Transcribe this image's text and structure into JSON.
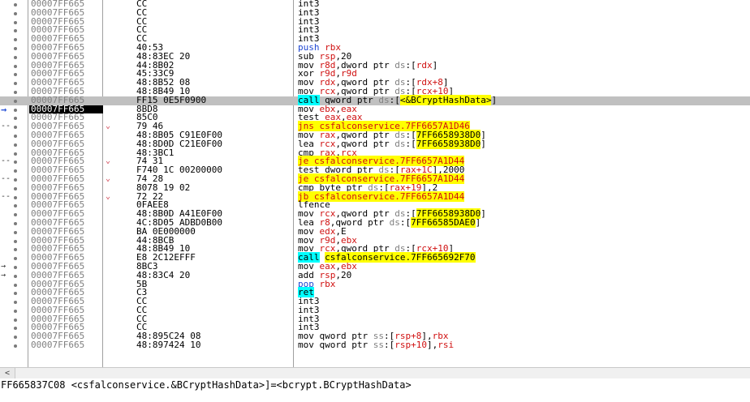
{
  "colors": {
    "call_bg": "#00ffff",
    "jcc_bg": "#ffff00",
    "selected_row": "#c0c0c0",
    "register": "#d01010",
    "push": "#1e46d2"
  },
  "rows": [
    {
      "addr": "00007FF665",
      "bytes": "CC",
      "instr": [
        [
          "int3",
          ""
        ]
      ]
    },
    {
      "addr": "00007FF665",
      "bytes": "CC",
      "instr": [
        [
          "int3",
          ""
        ]
      ]
    },
    {
      "addr": "00007FF665",
      "bytes": "CC",
      "instr": [
        [
          "int3",
          ""
        ]
      ]
    },
    {
      "addr": "00007FF665",
      "bytes": "CC",
      "instr": [
        [
          "int3",
          ""
        ]
      ]
    },
    {
      "addr": "00007FF665",
      "bytes": "CC",
      "instr": [
        [
          "int3",
          ""
        ]
      ]
    },
    {
      "addr": "00007FF665",
      "bytes": "40:53",
      "instr": [
        [
          "push",
          "push"
        ],
        [
          " ",
          ""
        ],
        [
          "rbx",
          "reg"
        ]
      ]
    },
    {
      "addr": "00007FF665",
      "bytes": "48:83EC 20",
      "instr": [
        [
          "sub ",
          ""
        ],
        [
          "rsp",
          "reg"
        ],
        [
          ",20",
          ""
        ]
      ]
    },
    {
      "addr": "00007FF665",
      "bytes": "44:8B02",
      "instr": [
        [
          "mov ",
          ""
        ],
        [
          "r8d",
          "reg"
        ],
        [
          ",dword ptr ",
          ""
        ],
        [
          "ds",
          "seg"
        ],
        [
          ":[",
          ""
        ],
        [
          "rdx",
          "reg"
        ],
        [
          "]",
          ""
        ]
      ]
    },
    {
      "addr": "00007FF665",
      "bytes": "45:33C9",
      "instr": [
        [
          "xor ",
          ""
        ],
        [
          "r9d",
          "reg"
        ],
        [
          ",",
          ""
        ],
        [
          "r9d",
          "reg"
        ]
      ]
    },
    {
      "addr": "00007FF665",
      "bytes": "48:8B52 08",
      "instr": [
        [
          "mov ",
          ""
        ],
        [
          "rdx",
          "reg"
        ],
        [
          ",qword ptr ",
          ""
        ],
        [
          "ds",
          "seg"
        ],
        [
          ":[",
          ""
        ],
        [
          "rdx+8",
          "reg"
        ],
        [
          "]",
          ""
        ]
      ]
    },
    {
      "addr": "00007FF665",
      "bytes": "48:8B49 10",
      "instr": [
        [
          "mov ",
          ""
        ],
        [
          "rcx",
          "reg"
        ],
        [
          ",qword ptr ",
          ""
        ],
        [
          "ds",
          "seg"
        ],
        [
          ":[",
          ""
        ],
        [
          "rcx+10",
          "reg"
        ],
        [
          "]",
          ""
        ]
      ]
    },
    {
      "addr": "00007FF665",
      "bytes": "FF15 0E5F0900",
      "instr": [
        [
          "call",
          "call"
        ],
        [
          " qword ptr ",
          ""
        ],
        [
          "ds",
          "seg"
        ],
        [
          ":[",
          ""
        ],
        [
          "<&BCryptHashData>",
          "tgt"
        ],
        [
          "]",
          ""
        ]
      ],
      "selected": true
    },
    {
      "addr": "00007FF665",
      "bytes": "8BD8",
      "instr": [
        [
          "mov ",
          ""
        ],
        [
          "ebx",
          "reg"
        ],
        [
          ",",
          ""
        ],
        [
          "eax",
          "reg"
        ]
      ],
      "current": true
    },
    {
      "addr": "00007FF665",
      "bytes": "85C0",
      "instr": [
        [
          "test ",
          ""
        ],
        [
          "eax",
          "reg"
        ],
        [
          ",",
          ""
        ],
        [
          "eax",
          "reg"
        ]
      ]
    },
    {
      "addr": "00007FF665",
      "bytes": "79 46",
      "instr": [
        [
          "jns csfalconservice.7FF6657A1D46",
          "jcc"
        ]
      ],
      "jmp": true
    },
    {
      "addr": "00007FF665",
      "bytes": "48:8B05 C91E0F00",
      "instr": [
        [
          "mov ",
          ""
        ],
        [
          "rax",
          "reg"
        ],
        [
          ",qword ptr ",
          ""
        ],
        [
          "ds",
          "seg"
        ],
        [
          ":[",
          ""
        ],
        [
          "7FF6658938D0",
          "tgt"
        ],
        [
          "]",
          ""
        ]
      ]
    },
    {
      "addr": "00007FF665",
      "bytes": "48:8D0D C21E0F00",
      "instr": [
        [
          "lea ",
          ""
        ],
        [
          "rcx",
          "reg"
        ],
        [
          ",qword ptr ",
          ""
        ],
        [
          "ds",
          "seg"
        ],
        [
          ":[",
          ""
        ],
        [
          "7FF6658938D0",
          "tgt"
        ],
        [
          "]",
          ""
        ]
      ]
    },
    {
      "addr": "00007FF665",
      "bytes": "48:3BC1",
      "instr": [
        [
          "cmp ",
          ""
        ],
        [
          "rax",
          "reg"
        ],
        [
          ",",
          ""
        ],
        [
          "rcx",
          "reg"
        ]
      ]
    },
    {
      "addr": "00007FF665",
      "bytes": "74 31",
      "instr": [
        [
          "je csfalconservice.7FF6657A1D44",
          "jcc"
        ]
      ],
      "jmp": true
    },
    {
      "addr": "00007FF665",
      "bytes": "F740 1C 00200000",
      "instr": [
        [
          "test dword ptr ",
          ""
        ],
        [
          "ds",
          "seg"
        ],
        [
          ":[",
          ""
        ],
        [
          "rax+1C",
          "reg"
        ],
        [
          "],2000",
          ""
        ]
      ]
    },
    {
      "addr": "00007FF665",
      "bytes": "74 28",
      "instr": [
        [
          "je csfalconservice.7FF6657A1D44",
          "jcc"
        ]
      ],
      "jmp": true
    },
    {
      "addr": "00007FF665",
      "bytes": "8078 19 02",
      "instr": [
        [
          "cmp byte ptr ",
          ""
        ],
        [
          "ds",
          "seg"
        ],
        [
          ":[",
          ""
        ],
        [
          "rax+19",
          "reg"
        ],
        [
          "],2",
          ""
        ]
      ]
    },
    {
      "addr": "00007FF665",
      "bytes": "72 22",
      "instr": [
        [
          "jb csfalconservice.7FF6657A1D44",
          "jcc"
        ]
      ],
      "jmp": true
    },
    {
      "addr": "00007FF665",
      "bytes": "0FAEE8",
      "instr": [
        [
          "lfence",
          ""
        ]
      ]
    },
    {
      "addr": "00007FF665",
      "bytes": "48:8B0D A41E0F00",
      "instr": [
        [
          "mov ",
          ""
        ],
        [
          "rcx",
          "reg"
        ],
        [
          ",qword ptr ",
          ""
        ],
        [
          "ds",
          "seg"
        ],
        [
          ":[",
          ""
        ],
        [
          "7FF6658938D0",
          "tgt"
        ],
        [
          "]",
          ""
        ]
      ]
    },
    {
      "addr": "00007FF665",
      "bytes": "4C:8D05 ADBD0B00",
      "instr": [
        [
          "lea ",
          ""
        ],
        [
          "r8",
          "reg"
        ],
        [
          ",qword ptr ",
          ""
        ],
        [
          "ds",
          "seg"
        ],
        [
          ":[",
          ""
        ],
        [
          "7FF66585DAE0",
          "tgt"
        ],
        [
          "]",
          ""
        ]
      ]
    },
    {
      "addr": "00007FF665",
      "bytes": "BA 0E000000",
      "instr": [
        [
          "mov ",
          ""
        ],
        [
          "edx",
          "reg"
        ],
        [
          ",E",
          ""
        ]
      ]
    },
    {
      "addr": "00007FF665",
      "bytes": "44:8BCB",
      "instr": [
        [
          "mov ",
          ""
        ],
        [
          "r9d",
          "reg"
        ],
        [
          ",",
          ""
        ],
        [
          "ebx",
          "reg"
        ]
      ]
    },
    {
      "addr": "00007FF665",
      "bytes": "48:8B49 10",
      "instr": [
        [
          "mov ",
          ""
        ],
        [
          "rcx",
          "reg"
        ],
        [
          ",qword ptr ",
          ""
        ],
        [
          "ds",
          "seg"
        ],
        [
          ":[",
          ""
        ],
        [
          "rcx+10",
          "reg"
        ],
        [
          "]",
          ""
        ]
      ]
    },
    {
      "addr": "00007FF665",
      "bytes": "E8 2C12EFFF",
      "instr": [
        [
          "call",
          "call"
        ],
        [
          " ",
          ""
        ],
        [
          "csfalconservice.7FF665692F70",
          "tgt"
        ]
      ]
    },
    {
      "addr": "00007FF665",
      "bytes": "8BC3",
      "instr": [
        [
          "mov ",
          ""
        ],
        [
          "eax",
          "reg"
        ],
        [
          ",",
          ""
        ],
        [
          "ebx",
          "reg"
        ]
      ],
      "inarrow": true
    },
    {
      "addr": "00007FF665",
      "bytes": "48:83C4 20",
      "instr": [
        [
          "add ",
          ""
        ],
        [
          "rsp",
          "reg"
        ],
        [
          ",20",
          ""
        ]
      ],
      "inarrow": true
    },
    {
      "addr": "00007FF665",
      "bytes": "5B",
      "instr": [
        [
          "pop",
          "push"
        ],
        [
          " ",
          ""
        ],
        [
          "rbx",
          "reg"
        ]
      ]
    },
    {
      "addr": "00007FF665",
      "bytes": "C3",
      "instr": [
        [
          "ret",
          "ret"
        ]
      ]
    },
    {
      "addr": "00007FF665",
      "bytes": "CC",
      "instr": [
        [
          "int3",
          ""
        ]
      ]
    },
    {
      "addr": "00007FF665",
      "bytes": "CC",
      "instr": [
        [
          "int3",
          ""
        ]
      ]
    },
    {
      "addr": "00007FF665",
      "bytes": "CC",
      "instr": [
        [
          "int3",
          ""
        ]
      ]
    },
    {
      "addr": "00007FF665",
      "bytes": "CC",
      "instr": [
        [
          "int3",
          ""
        ]
      ]
    },
    {
      "addr": "00007FF665",
      "bytes": "48:895C24 08",
      "instr": [
        [
          "mov qword ptr ",
          ""
        ],
        [
          "ss",
          "seg"
        ],
        [
          ":[",
          ""
        ],
        [
          "rsp+8",
          "reg"
        ],
        [
          "],",
          ""
        ],
        [
          "rbx",
          "reg"
        ]
      ]
    },
    {
      "addr": "00007FF665",
      "bytes": "48:897424 10",
      "instr": [
        [
          "mov qword ptr ",
          ""
        ],
        [
          "ss",
          "seg"
        ],
        [
          ":[",
          ""
        ],
        [
          "rsp+10",
          "reg"
        ],
        [
          "],",
          ""
        ],
        [
          "rsi",
          "reg"
        ]
      ]
    }
  ],
  "scrollbar": {
    "left_arrow": "<"
  },
  "status_text": "FF665837C08 <csfalconservice.&BCryptHashData>]=<bcrypt.BCryptHashData>"
}
